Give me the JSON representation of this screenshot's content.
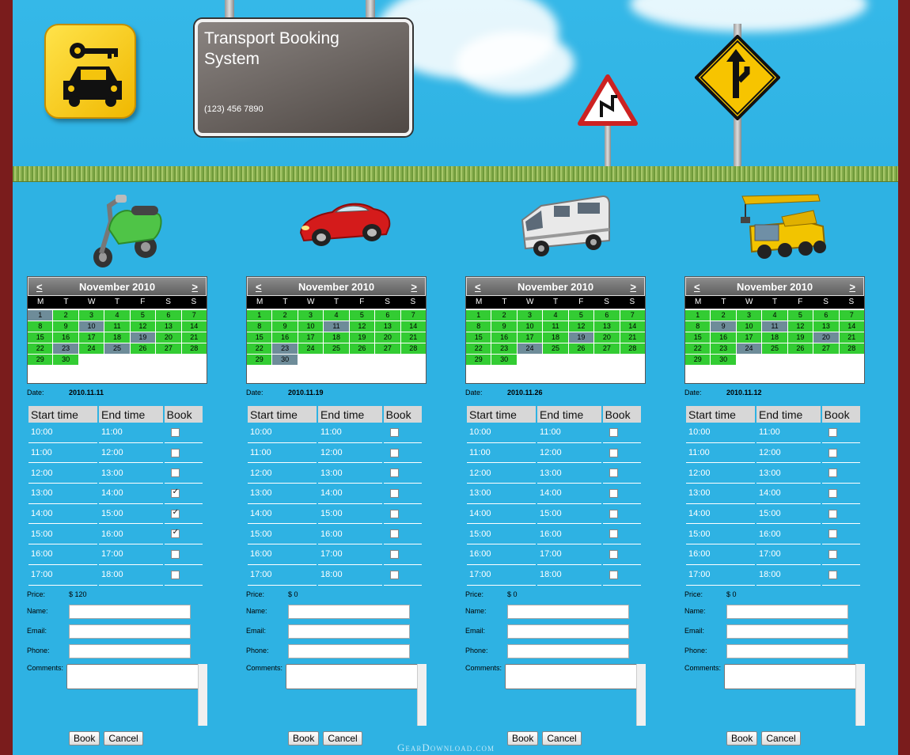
{
  "header": {
    "title": "Transport Booking System",
    "phone": "(123) 456 7890"
  },
  "calendar_common": {
    "month_label": "November 2010",
    "prev": "<",
    "next": ">",
    "weekdays": [
      "M",
      "T",
      "W",
      "T",
      "F",
      "S",
      "S"
    ]
  },
  "labels": {
    "date": "Date:",
    "start_time": "Start time",
    "end_time": "End time",
    "book": "Book",
    "price": "Price:",
    "name": "Name:",
    "email": "Email:",
    "phone": "Phone:",
    "comments": "Comments:",
    "book_button": "Book",
    "cancel_button": "Cancel"
  },
  "slots": [
    {
      "start": "10:00",
      "end": "11:00"
    },
    {
      "start": "11:00",
      "end": "12:00"
    },
    {
      "start": "12:00",
      "end": "13:00"
    },
    {
      "start": "13:00",
      "end": "14:00"
    },
    {
      "start": "14:00",
      "end": "15:00"
    },
    {
      "start": "15:00",
      "end": "16:00"
    },
    {
      "start": "16:00",
      "end": "17:00"
    },
    {
      "start": "17:00",
      "end": "18:00"
    }
  ],
  "vehicles": [
    {
      "icon": "scooter-icon",
      "date": "2010.11.11",
      "price": "$ 120",
      "selected_days": [
        1,
        10,
        19,
        23,
        25
      ],
      "booked": [
        false,
        false,
        false,
        true,
        true,
        true,
        false,
        false
      ]
    },
    {
      "icon": "sports-car-icon",
      "date": "2010.11.19",
      "price": "$ 0",
      "selected_days": [
        11,
        23,
        30
      ],
      "booked": [
        false,
        false,
        false,
        false,
        false,
        false,
        false,
        false
      ]
    },
    {
      "icon": "camper-van-icon",
      "date": "2010.11.26",
      "price": "$ 0",
      "selected_days": [
        19,
        24
      ],
      "booked": [
        false,
        false,
        false,
        false,
        false,
        false,
        false,
        false
      ]
    },
    {
      "icon": "crane-truck-icon",
      "date": "2010.11.12",
      "price": "$ 0",
      "selected_days": [
        9,
        11,
        20,
        24
      ],
      "booked": [
        false,
        false,
        false,
        false,
        false,
        false,
        false,
        false
      ]
    }
  ],
  "watermark": "GearDownload.com"
}
